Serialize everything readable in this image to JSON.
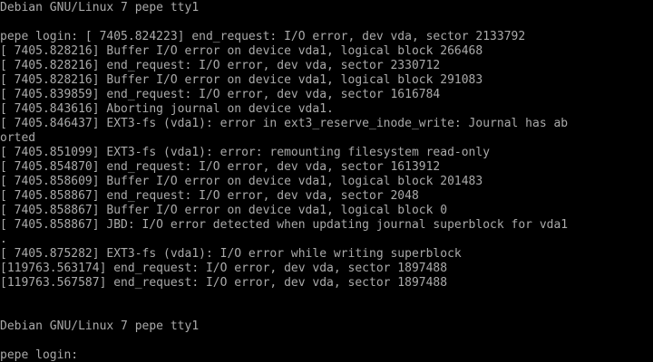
{
  "console": {
    "fg_color": "#aaaaaa",
    "bg_color": "#000000",
    "lines": [
      "Debian GNU/Linux 7 pepe tty1",
      "",
      "pepe login: [ 7405.824223] end_request: I/O error, dev vda, sector 2133792",
      "[ 7405.828216] Buffer I/O error on device vda1, logical block 266468",
      "[ 7405.828216] end_request: I/O error, dev vda, sector 2330712",
      "[ 7405.828216] Buffer I/O error on device vda1, logical block 291083",
      "[ 7405.839859] end_request: I/O error, dev vda, sector 1616784",
      "[ 7405.843616] Aborting journal on device vda1.",
      "[ 7405.846437] EXT3-fs (vda1): error in ext3_reserve_inode_write: Journal has ab",
      "orted",
      "[ 7405.851099] EXT3-fs (vda1): error: remounting filesystem read-only",
      "[ 7405.854870] end_request: I/O error, dev vda, sector 1613912",
      "[ 7405.858609] Buffer I/O error on device vda1, logical block 201483",
      "[ 7405.858867] end_request: I/O error, dev vda, sector 2048",
      "[ 7405.858867] Buffer I/O error on device vda1, logical block 0",
      "[ 7405.858867] JBD: I/O error detected when updating journal superblock for vda1",
      ".",
      "[ 7405.875282] EXT3-fs (vda1): I/O error while writing superblock",
      "[119763.563174] end_request: I/O error, dev vda, sector 1897488",
      "[119763.567587] end_request: I/O error, dev vda, sector 1897488",
      "",
      "",
      "Debian GNU/Linux 7 pepe tty1",
      "",
      "pepe login: "
    ]
  }
}
